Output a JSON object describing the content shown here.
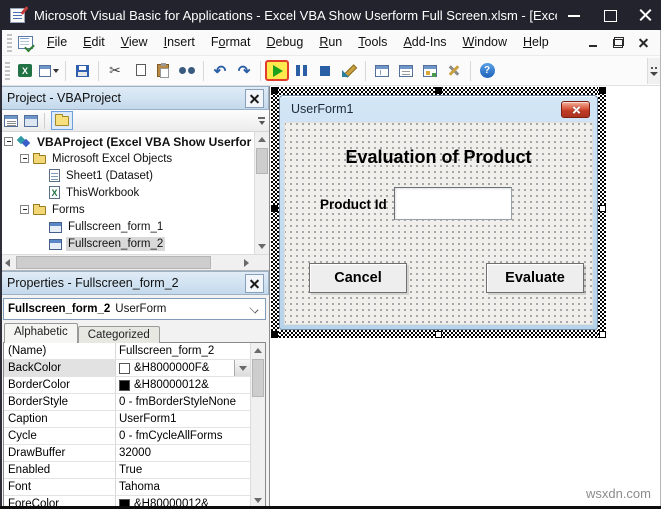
{
  "window": {
    "title": "Microsoft Visual Basic for Applications - Excel VBA Show Userform Full Screen.xlsm - [Exce...",
    "controls": [
      "minimize",
      "maximize",
      "close"
    ]
  },
  "menu": {
    "items": [
      {
        "label": "File",
        "accel": 0
      },
      {
        "label": "Edit",
        "accel": 0
      },
      {
        "label": "View",
        "accel": 0
      },
      {
        "label": "Insert",
        "accel": 0
      },
      {
        "label": "Format",
        "accel": 1
      },
      {
        "label": "Debug",
        "accel": 0
      },
      {
        "label": "Run",
        "accel": 0
      },
      {
        "label": "Tools",
        "accel": 0
      },
      {
        "label": "Add-Ins",
        "accel": 0
      },
      {
        "label": "Window",
        "accel": 0
      },
      {
        "label": "Help",
        "accel": 0
      }
    ],
    "mdi_controls": [
      "minimize",
      "restore",
      "close"
    ]
  },
  "toolbar": {
    "buttons": [
      {
        "name": "view-microsoft-excel"
      },
      {
        "name": "insert-userform",
        "dropdown": true
      },
      {
        "sep": true
      },
      {
        "name": "save"
      },
      {
        "sep": true
      },
      {
        "name": "cut"
      },
      {
        "name": "copy"
      },
      {
        "name": "paste"
      },
      {
        "name": "find"
      },
      {
        "sep": true
      },
      {
        "name": "undo"
      },
      {
        "name": "redo"
      },
      {
        "sep": true
      },
      {
        "name": "run-sub-userform",
        "highlighted": true
      },
      {
        "name": "break"
      },
      {
        "name": "reset"
      },
      {
        "name": "design-mode"
      },
      {
        "sep": true
      },
      {
        "name": "project-explorer"
      },
      {
        "name": "properties-window"
      },
      {
        "name": "object-browser"
      },
      {
        "name": "toolbox"
      },
      {
        "sep": true
      },
      {
        "name": "help"
      }
    ],
    "highlight": {
      "bg": "#ffe94d",
      "border": "#e23d2a"
    }
  },
  "project_panel": {
    "title": "Project - VBAProject",
    "tools": [
      "view-code",
      "view-object",
      "toggle-folders"
    ],
    "tree": [
      {
        "label": "VBAProject (Excel VBA Show Userfor",
        "icon": "project",
        "depth": 0,
        "bold": true,
        "expander": true
      },
      {
        "label": "Microsoft Excel Objects",
        "icon": "folder",
        "depth": 1,
        "expander": true
      },
      {
        "label": "Sheet1 (Dataset)",
        "icon": "worksheet",
        "depth": 2
      },
      {
        "label": "ThisWorkbook",
        "icon": "workbook",
        "depth": 2
      },
      {
        "label": "Forms",
        "icon": "folder",
        "depth": 1,
        "expander": true
      },
      {
        "label": "Fullscreen_form_1",
        "icon": "userform",
        "depth": 2
      },
      {
        "label": "Fullscreen_form_2",
        "icon": "userform",
        "depth": 2,
        "selected": true
      }
    ]
  },
  "properties_panel": {
    "title": "Properties - Fullscreen_form_2",
    "selector": {
      "name": "Fullscreen_form_2",
      "type": "UserForm"
    },
    "tabs": [
      "Alphabetic",
      "Categorized"
    ],
    "active_tab": "Alphabetic",
    "rows": [
      {
        "name": "(Name)",
        "value": "Fullscreen_form_2"
      },
      {
        "name": "BackColor",
        "value": "&H8000000F&",
        "swatch": "#ffffff",
        "selected": true,
        "dropdown": true
      },
      {
        "name": "BorderColor",
        "value": "&H80000012&",
        "swatch": "#000000"
      },
      {
        "name": "BorderStyle",
        "value": "0 - fmBorderStyleNone"
      },
      {
        "name": "Caption",
        "value": "UserForm1"
      },
      {
        "name": "Cycle",
        "value": "0 - fmCycleAllForms"
      },
      {
        "name": "DrawBuffer",
        "value": "32000"
      },
      {
        "name": "Enabled",
        "value": "True"
      },
      {
        "name": "Font",
        "value": "Tahoma"
      },
      {
        "name": "ForeColor",
        "value": "&H80000012&",
        "swatch": "#000000"
      }
    ]
  },
  "designer": {
    "form": {
      "caption": "UserForm1",
      "heading": "Evaluation of Product",
      "product_label": "Product Id",
      "input_value": "",
      "cancel_label": "Cancel",
      "evaluate_label": "Evaluate"
    },
    "selection_handles": 8
  },
  "watermark": "wsxdn.com",
  "colors": {
    "titlebar_bg": "#23232d",
    "panel_header_top": "#e0ecf7",
    "panel_header_bottom": "#c4d9ec",
    "run_highlight_bg": "#ffe94d",
    "run_highlight_border": "#e23d2a",
    "form_frame": "#bdd6ec",
    "form_close_red": "#c03a25"
  }
}
